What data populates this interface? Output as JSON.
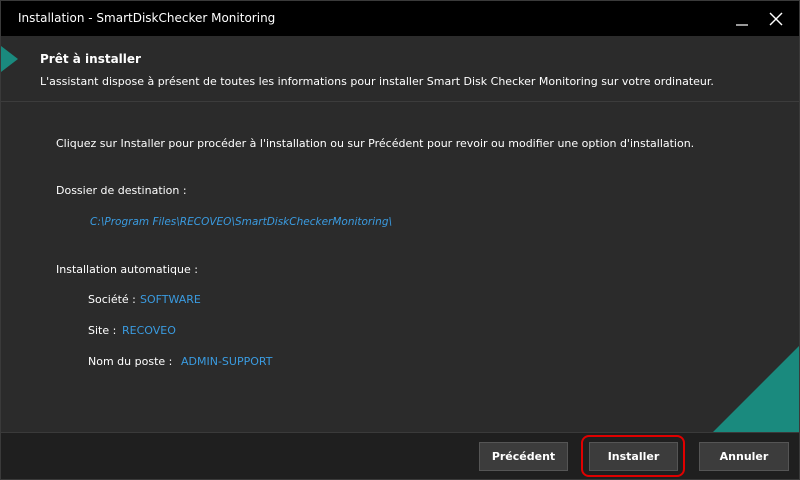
{
  "window": {
    "title": "Installation - SmartDiskChecker Monitoring"
  },
  "header": {
    "title": "Prêt à installer",
    "subtitle": "L'assistant dispose à présent de toutes les informations pour installer Smart Disk Checker Monitoring sur votre ordinateur."
  },
  "body": {
    "intro": "Cliquez sur Installer pour procéder à l'installation ou sur Précédent pour revoir ou modifier une option d'installation.",
    "dest_label": "Dossier de destination :",
    "dest_path": "C:\\Program Files\\RECOVEO\\SmartDiskCheckerMonitoring\\",
    "auto_label": "Installation automatique :",
    "fields": [
      {
        "label": "Société :",
        "value": "SOFTWARE"
      },
      {
        "label": "Site :",
        "value": "RECOVEO"
      },
      {
        "label": "Nom du poste :",
        "value": "ADMIN-SUPPORT"
      }
    ]
  },
  "footer": {
    "back_label": "Précédent",
    "install_label": "Installer",
    "cancel_label": "Annuler"
  },
  "colors": {
    "accent": "#1a8a7e",
    "link": "#3a9be0",
    "highlight": "#e00000"
  },
  "icons": [
    "minimize-icon",
    "close-icon",
    "header-arrow-icon"
  ]
}
